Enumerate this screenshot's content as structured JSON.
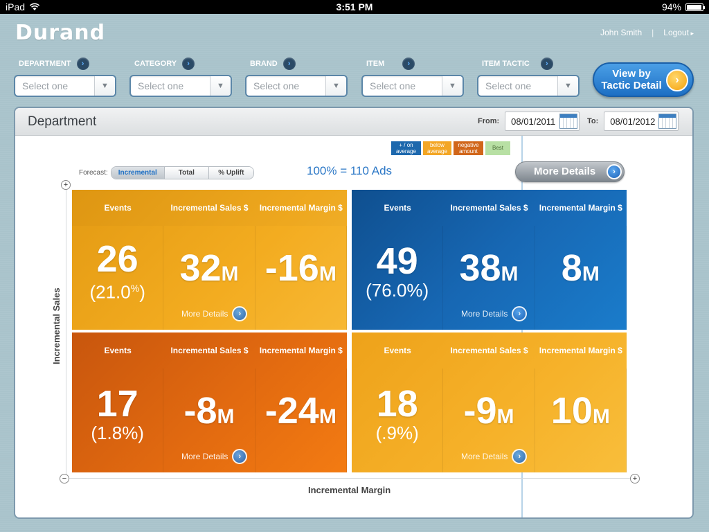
{
  "statusbar": {
    "device": "iPad",
    "time": "3:51 PM",
    "battery": "94%",
    "battery_level": 0.94
  },
  "header": {
    "logo": "Durand",
    "user": "John Smith",
    "sep": "|",
    "logout": "Logout"
  },
  "filters": [
    {
      "label": "DEPARTMENT",
      "value": "Select one"
    },
    {
      "label": "CATEGORY",
      "value": "Select one"
    },
    {
      "label": "BRAND",
      "value": "Select one"
    },
    {
      "label": "ITEM",
      "value": "Select one"
    },
    {
      "label": "ITEM TACTIC",
      "value": "Select one"
    }
  ],
  "view_button": {
    "line1": "View by",
    "line2": "Tactic Detail"
  },
  "panel": {
    "title": "Department",
    "from_label": "From:",
    "from_date": "08/01/2011",
    "to_label": "To:",
    "to_date": "08/01/2012"
  },
  "legend": {
    "above": "+ / on average",
    "below": "below average",
    "negative": "negative amount",
    "best": "Best"
  },
  "forecast": {
    "label": "Forecast:",
    "options": [
      "Incremental",
      "Total",
      "% Uplift"
    ],
    "selected": "Incremental"
  },
  "scale_text": "100% = 110 Ads",
  "more_details_label": "More Details",
  "axes": {
    "y": "Incremental Sales",
    "x": "Incremental Margin",
    "plus": "+",
    "minus": "−"
  },
  "columns": {
    "events": "Events",
    "sales": "Incremental Sales $",
    "margin": "Incremental Margin $"
  },
  "quadrants": {
    "top_left": {
      "events": "26",
      "events_pct": "21.0",
      "sales": "-32",
      "sales_display": "32",
      "margin": "-16",
      "suffix": "M",
      "more": "More Details"
    },
    "top_right": {
      "events": "49",
      "events_pct": "76.0",
      "sales": "38",
      "margin": "8",
      "suffix": "M",
      "more": "More Details"
    },
    "bottom_left": {
      "events": "17",
      "events_pct": "1.8",
      "sales": "-8",
      "margin": "-24",
      "suffix": "M",
      "more": "More Details"
    },
    "bottom_right": {
      "events": "18",
      "events_pct": ".9",
      "sales": "-9",
      "margin": "10",
      "suffix": "M",
      "more": "More Details"
    }
  },
  "colors": {
    "blue": "#1767b3",
    "orange": "#f3ac20",
    "dark_orange": "#e26a10",
    "best_green": "#b8e0a4"
  }
}
